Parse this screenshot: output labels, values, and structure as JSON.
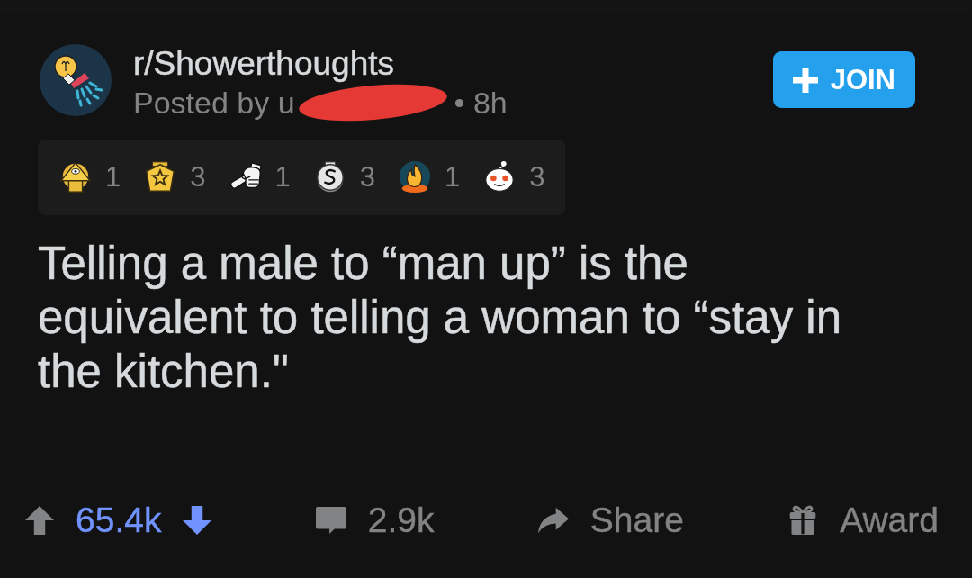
{
  "post": {
    "community": {
      "name": "r/Showerthoughts"
    },
    "byline": {
      "prefix": "Posted by u",
      "author_redacted": true,
      "age": "• 8h"
    },
    "join_button": {
      "label": "JOIN"
    },
    "awards": [
      {
        "kind": "pyramid",
        "count": "1"
      },
      {
        "kind": "star",
        "count": "3"
      },
      {
        "kind": "hand",
        "count": "1"
      },
      {
        "kind": "coin",
        "count": "3"
      },
      {
        "kind": "fire",
        "count": "1"
      },
      {
        "kind": "snoo",
        "count": "3"
      }
    ],
    "title": "Telling a male to “man up” is the equivalent to telling a woman to “stay in the kitchen.\"",
    "actions": {
      "upvoted": false,
      "downvoted": true,
      "score": "65.4k",
      "comments": "2.9k",
      "share": "Share",
      "award": "Award"
    }
  }
}
